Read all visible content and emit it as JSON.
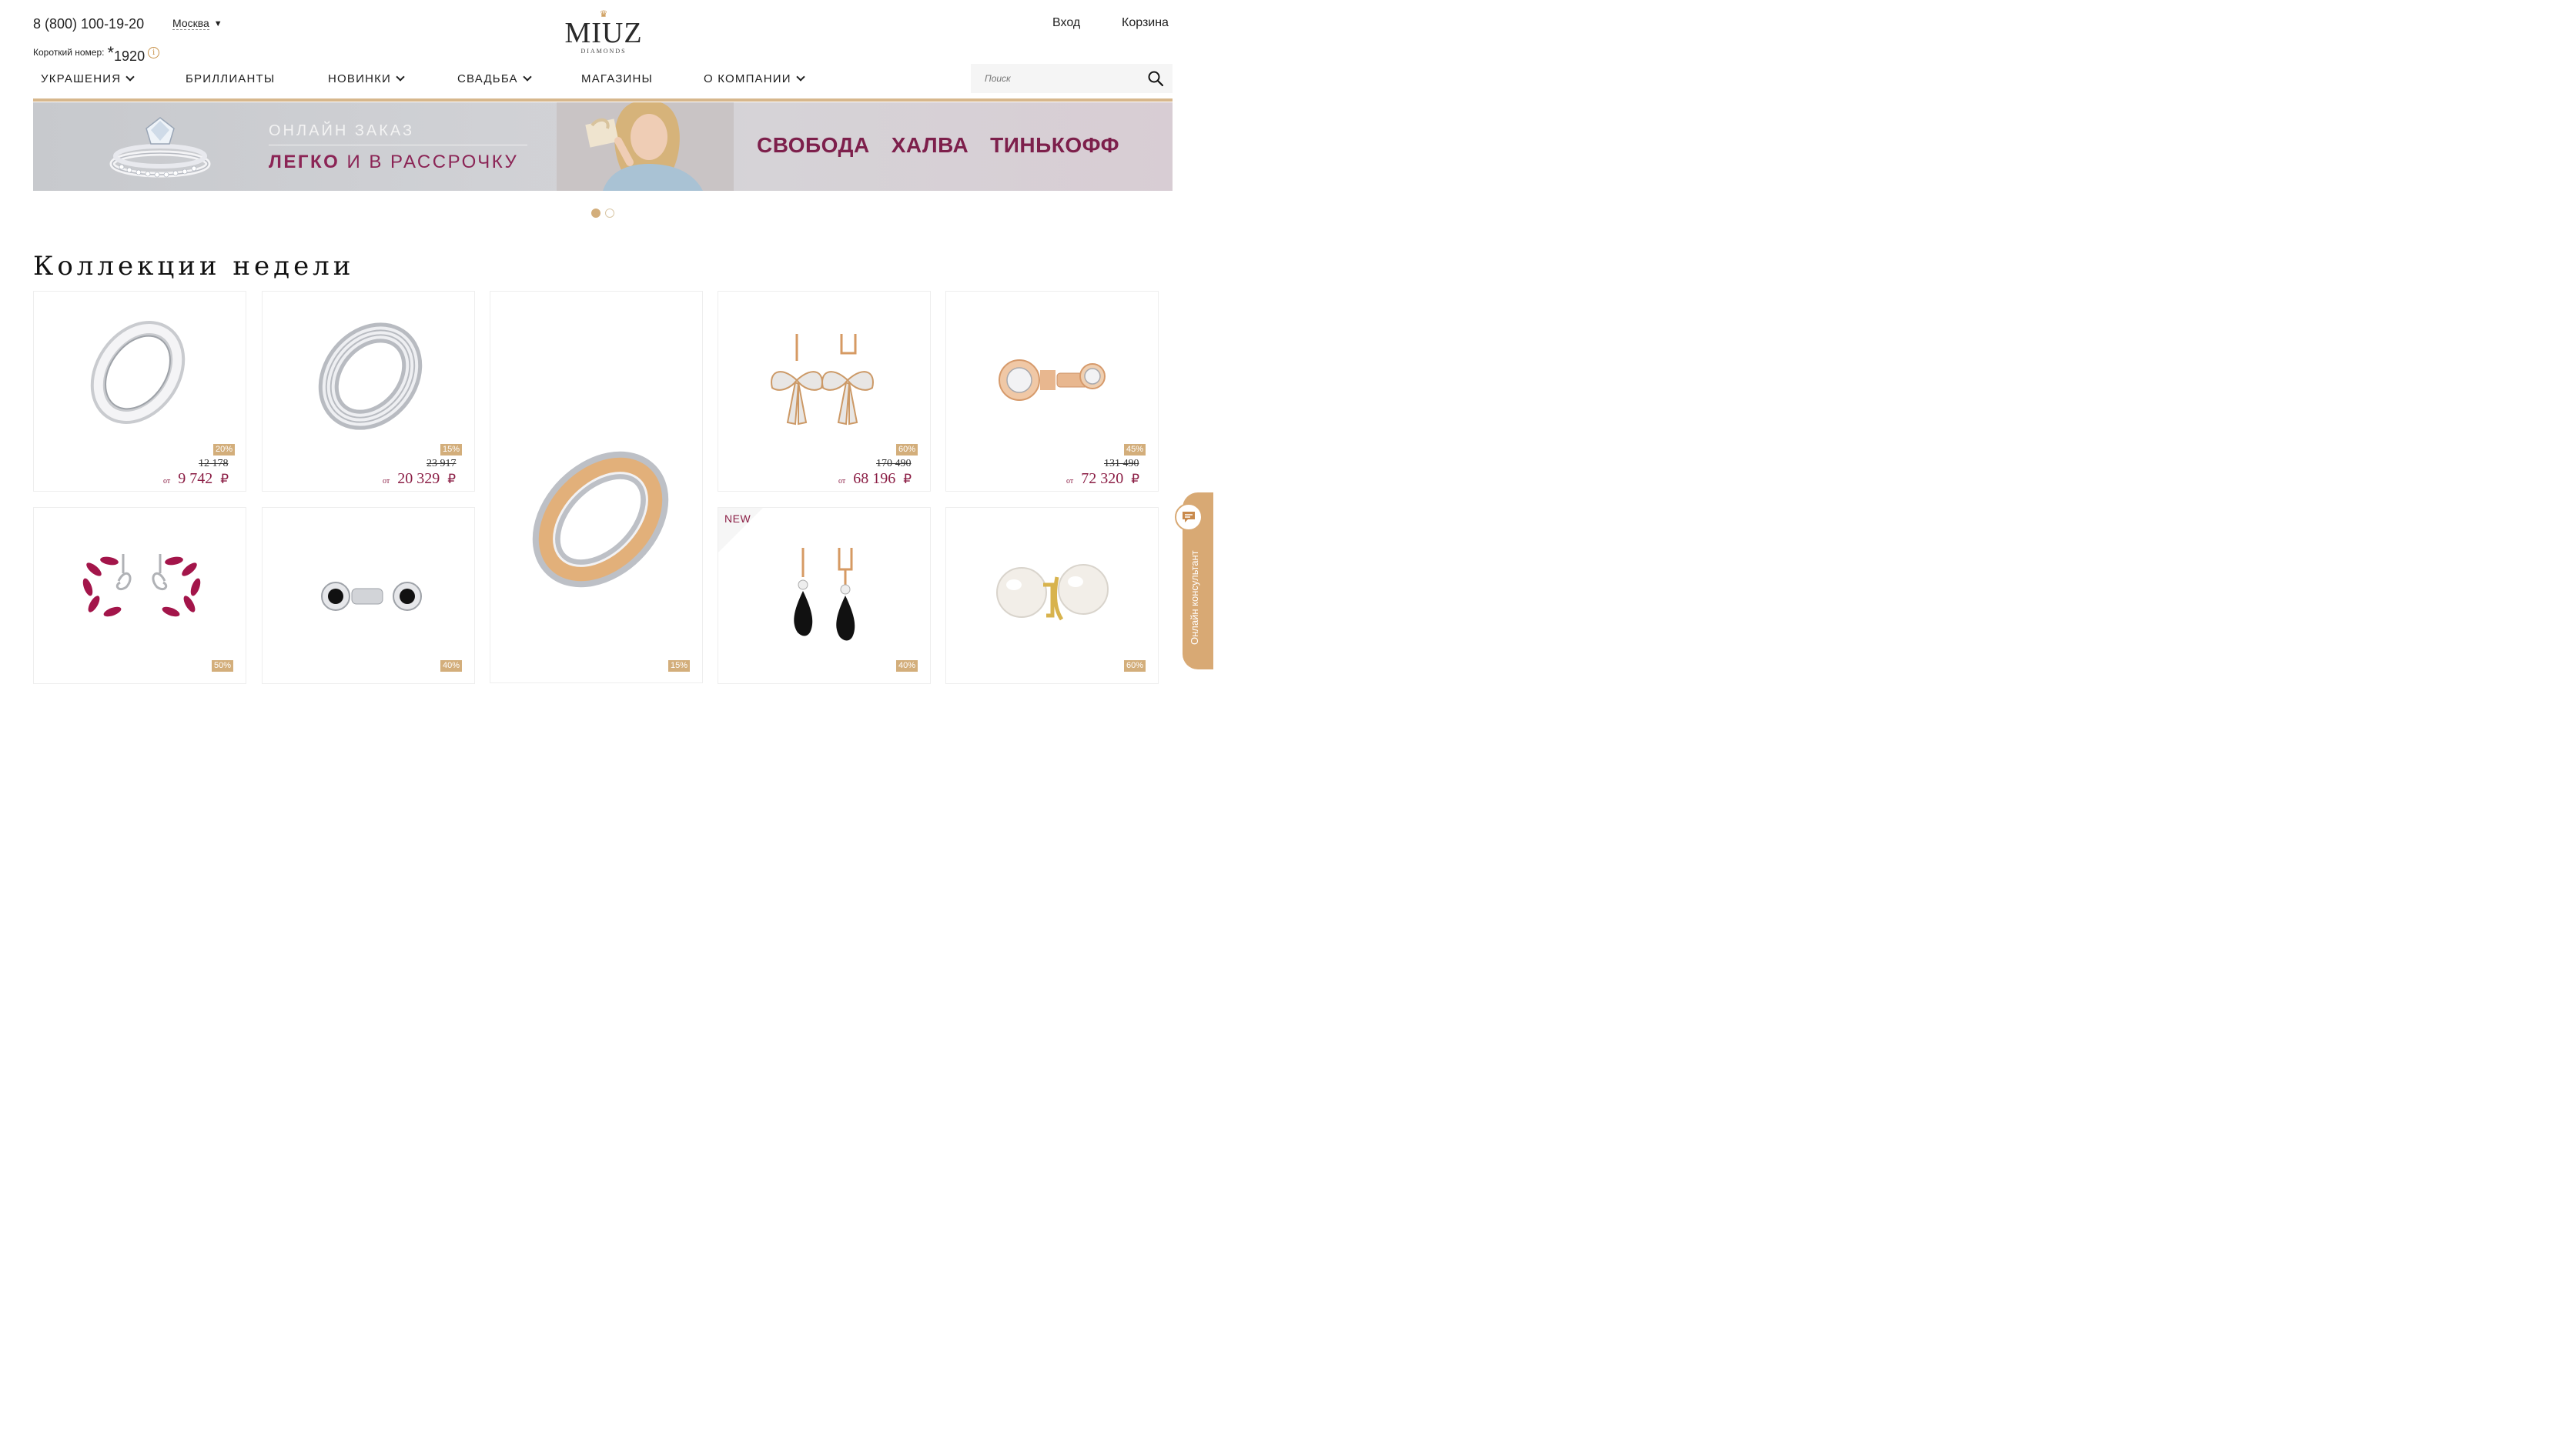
{
  "header": {
    "phone": "8 (800) 100-19-20",
    "city": "Москва",
    "short_label": "Короткий номер:",
    "short_star": "*",
    "short_number": "1920",
    "logo_brand": "MIUZ",
    "logo_sub": "DIAMONDS",
    "login": "Вход",
    "cart": "Корзина"
  },
  "nav": {
    "items": [
      {
        "label": "УКРАШЕНИЯ",
        "has_dropdown": true
      },
      {
        "label": "БРИЛЛИАНТЫ",
        "has_dropdown": false
      },
      {
        "label": "НОВИНКИ",
        "has_dropdown": true
      },
      {
        "label": "СВАДЬБА",
        "has_dropdown": true
      },
      {
        "label": "МАГАЗИНЫ",
        "has_dropdown": false
      },
      {
        "label": "О КОМПАНИИ",
        "has_dropdown": true
      }
    ]
  },
  "search": {
    "placeholder": "Поиск"
  },
  "banner": {
    "line1": "ОНЛАЙН ЗАКАЗ",
    "line2_bold": "ЛЕГКО",
    "line2_rest": "И В РАССРОЧКУ",
    "brands": [
      "СВОБОДА",
      "ХАЛВА",
      "ТИНЬКОФФ"
    ]
  },
  "carousel": {
    "total": 2,
    "active": 1
  },
  "section": {
    "title": "Коллекции недели"
  },
  "products": [
    {
      "badge": "20%",
      "old_price": "12 178",
      "from": "от",
      "price": "9 742",
      "currency": "₽"
    },
    {
      "badge": "15%",
      "old_price": "23 917",
      "from": "от",
      "price": "20 329",
      "currency": "₽"
    },
    {
      "badge": "60%",
      "old_price": "170 490",
      "from": "от",
      "price": "68 196",
      "currency": "₽"
    },
    {
      "badge": "45%",
      "old_price": "131 490",
      "from": "от",
      "price": "72 320",
      "currency": "₽"
    },
    {
      "badge": "50%"
    },
    {
      "badge": "40%"
    },
    {
      "badge": "15%"
    },
    {
      "badge": "40%",
      "is_new": true,
      "new_label": "NEW"
    },
    {
      "badge": "60%"
    }
  ],
  "consultant": {
    "label": "Онлайн консультант"
  },
  "colors": {
    "accent_gold": "#d3ae7b",
    "price_color": "#8b1e45",
    "banner_brand": "#7d1f4b"
  },
  "icons": {
    "search": "search-icon",
    "info": "info-icon",
    "chat": "chat-icon"
  }
}
